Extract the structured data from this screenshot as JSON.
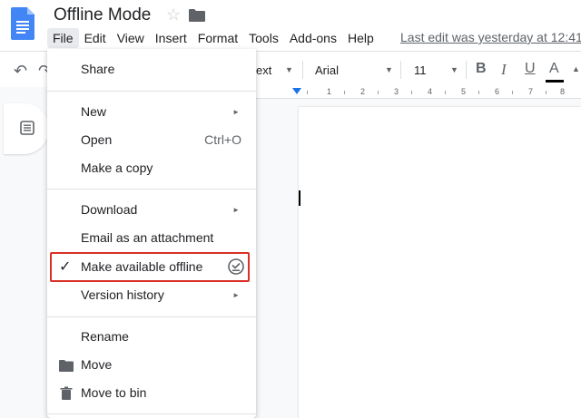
{
  "header": {
    "title": "Offline Mode",
    "last_edit": "Last edit was yesterday at 12:41"
  },
  "menubar": {
    "items": [
      "File",
      "Edit",
      "View",
      "Insert",
      "Format",
      "Tools",
      "Add-ons",
      "Help"
    ]
  },
  "toolbar": {
    "style_label": "ext",
    "font_label": "Arial",
    "size_label": "11",
    "bold": "B",
    "italic": "I",
    "underline": "U",
    "text_color": "A",
    "text_color_swatch": "#000000"
  },
  "ruler": {
    "labels": [
      "1",
      "2",
      "3",
      "4",
      "5",
      "6",
      "7",
      "8"
    ]
  },
  "file_menu": {
    "share": "Share",
    "new": "New",
    "open": "Open",
    "open_shortcut": "Ctrl+O",
    "make_copy": "Make a copy",
    "download": "Download",
    "email_attachment": "Email as an attachment",
    "make_offline": "Make available offline",
    "version_history": "Version history",
    "rename": "Rename",
    "move": "Move",
    "move_to_bin": "Move to bin"
  },
  "colors": {
    "highlight": "#d93025",
    "docs_blue": "#4285f4",
    "ruler_marker": "#1a73e8"
  }
}
